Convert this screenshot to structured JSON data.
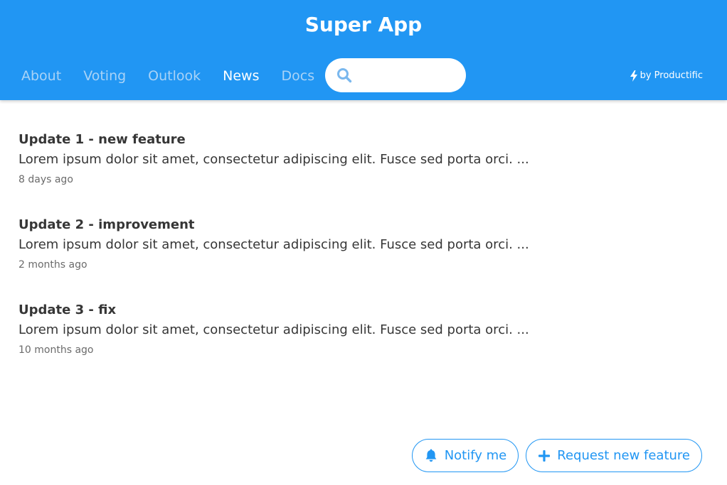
{
  "app": {
    "title": "Super App"
  },
  "nav": {
    "items": [
      {
        "label": "About",
        "active": false
      },
      {
        "label": "Voting",
        "active": false
      },
      {
        "label": "Outlook",
        "active": false
      },
      {
        "label": "News",
        "active": true
      },
      {
        "label": "Docs",
        "active": false
      }
    ]
  },
  "search": {
    "value": "",
    "placeholder": "",
    "icon": "search-icon"
  },
  "brand": {
    "icon": "bolt-icon",
    "label": "by Productific"
  },
  "news": [
    {
      "title": "Update 1 - new feature",
      "body": "Lorem ipsum dolor sit amet, consectetur adipiscing elit. Fusce sed porta orci. ...",
      "time": "8 days ago"
    },
    {
      "title": "Update 2 - improvement",
      "body": "Lorem ipsum dolor sit amet, consectetur adipiscing elit. Fusce sed porta orci. ...",
      "time": "2 months ago"
    },
    {
      "title": "Update 3 - fix",
      "body": "Lorem ipsum dolor sit amet, consectetur adipiscing elit. Fusce sed porta orci. ...",
      "time": "10 months ago"
    }
  ],
  "actions": {
    "notify_label": "Notify me",
    "notify_icon": "bell-icon",
    "request_label": "Request new feature",
    "request_icon": "plus-icon"
  },
  "colors": {
    "primary": "#2196f3",
    "nav_inactive": "#a9d3f7",
    "text": "#363636",
    "muted": "#6b6b6b"
  }
}
